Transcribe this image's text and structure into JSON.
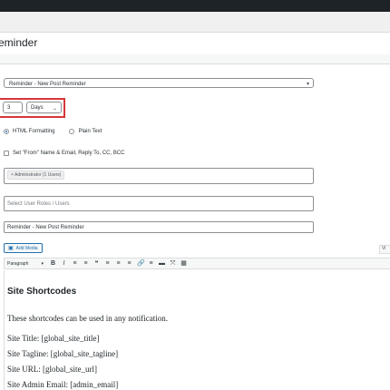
{
  "header": {
    "title": "eminder"
  },
  "form": {
    "notification_select": "Reminder - New Post Reminder",
    "number_value": "3",
    "unit_select": "Days",
    "format_options": [
      {
        "label": "HTML Formatting",
        "selected": true
      },
      {
        "label": "Plain Text",
        "selected": false
      }
    ],
    "from_checkbox_label": "Set \"From\" Name & Email, Reply To, CC, BCC",
    "recipient_tag": "× Administrator (1 Users)",
    "user_roles_placeholder": "Select User Roles / Users",
    "subject_value": "Reminder - New Post Reminder"
  },
  "editor": {
    "add_media_label": "Add Media",
    "visual_tab_label": "Vi",
    "format_select": "Paragraph",
    "toolbar_buttons": [
      "B",
      "I",
      "≡",
      "≡",
      "❝",
      "≡",
      "≡",
      "≡",
      "🔗",
      "≡",
      "▬",
      "⤧",
      "▦"
    ],
    "content": {
      "heading": "Site Shortcodes",
      "intro": "These shortcodes can be used in any notification.",
      "lines": [
        "Site Title: [global_site_title]",
        "Site Tagline: [global_site_tagline]",
        "Site URL: [global_site_url]",
        "Site Admin Email: [admin_email]"
      ]
    }
  },
  "colors": {
    "highlight": "#d63638",
    "accent": "#2271b1",
    "topbar": "#1d2327"
  }
}
